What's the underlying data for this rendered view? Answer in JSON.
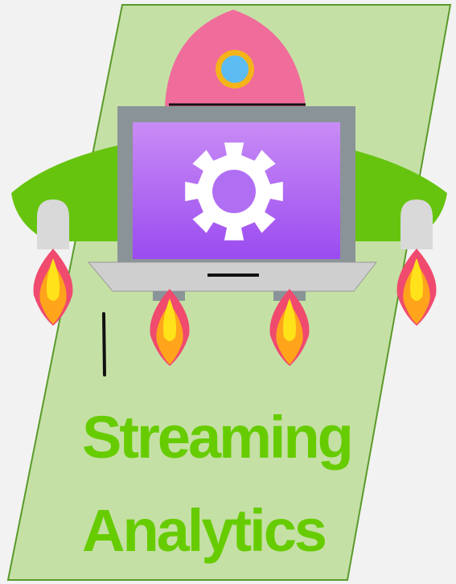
{
  "title": {
    "line1": "Streaming",
    "line2": "Analytics"
  },
  "colors": {
    "background": "#f2f2f2",
    "panel_fill": "#c5e0a5",
    "panel_border": "#5a9a2a",
    "title_text": "#66cc00",
    "wing": "#66c40f",
    "rocket_body": "#f06c9b",
    "window": "#5cbcf2",
    "window_ring": "#f4b41a",
    "laptop_frame": "#8a9398",
    "screen_top": "#c88cf5",
    "screen_bottom": "#9b4bf0",
    "gear": "#ffffff",
    "flame_outer": "#f04a6e",
    "flame_mid": "#ffa41b",
    "flame_core": "#ffe21a"
  },
  "icons": [
    "rocket-icon",
    "laptop-icon",
    "gear-icon",
    "flame-icon"
  ]
}
